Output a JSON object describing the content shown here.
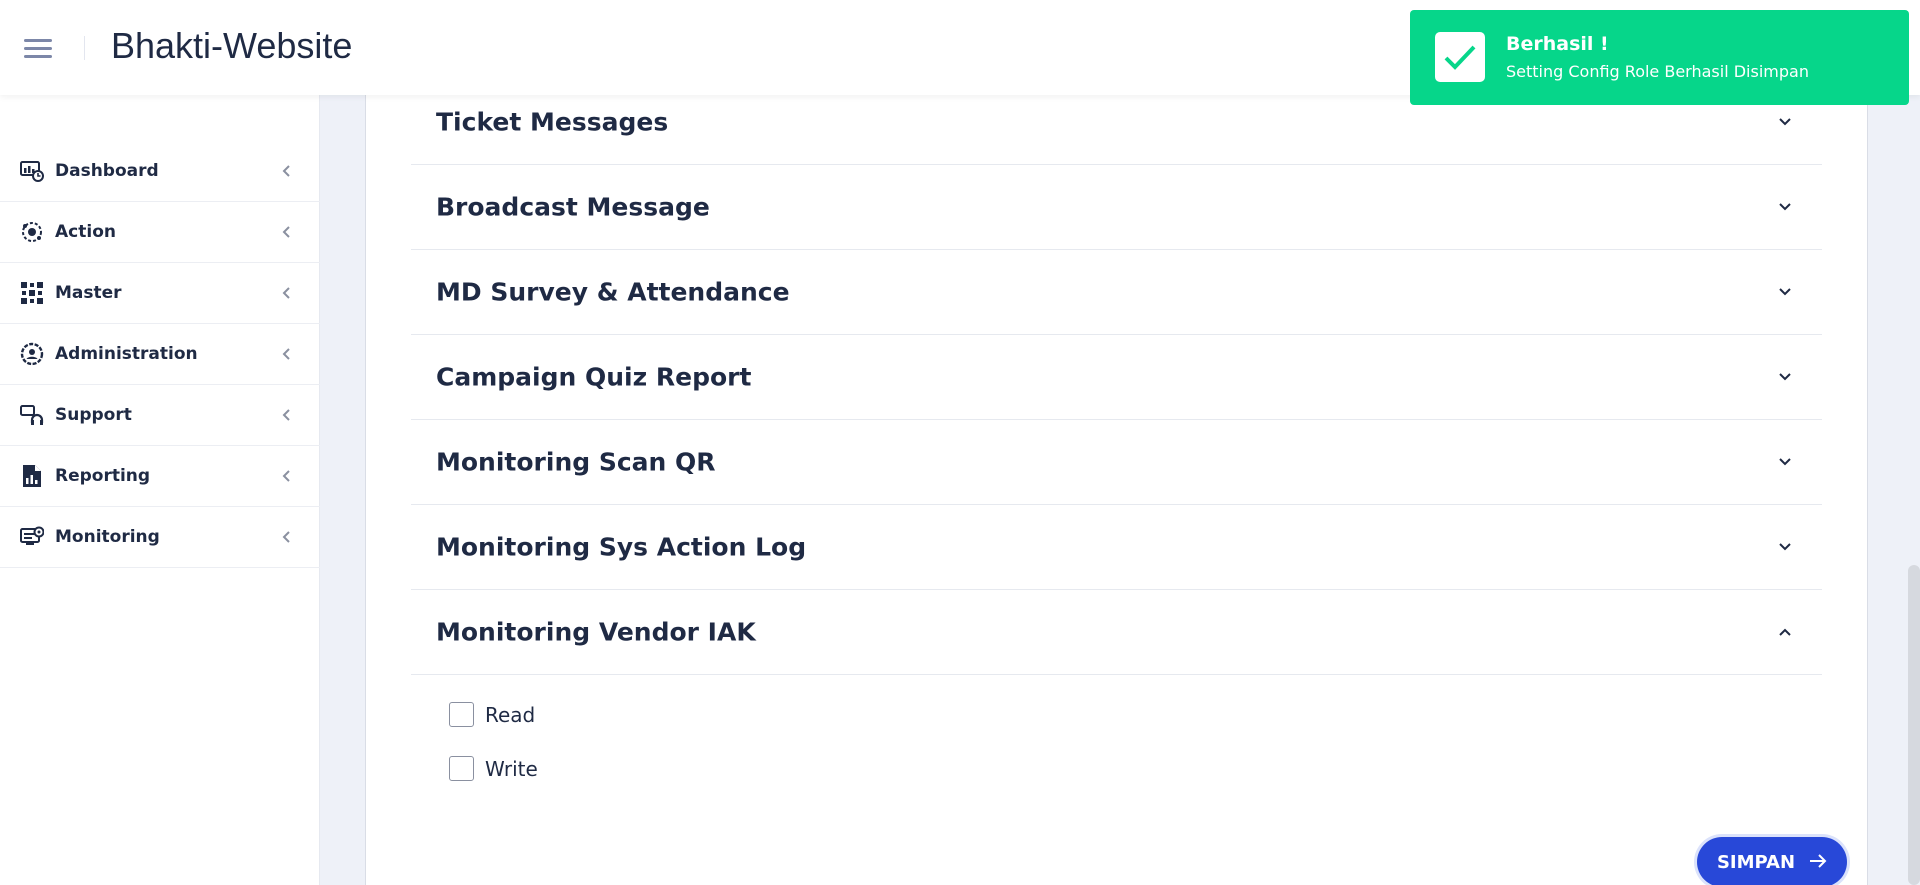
{
  "header": {
    "title": "Bhakti-Website"
  },
  "sidebar": {
    "items": [
      {
        "label": "Dashboard",
        "icon": "dashboard-icon"
      },
      {
        "label": "Action",
        "icon": "action-icon"
      },
      {
        "label": "Master",
        "icon": "master-icon"
      },
      {
        "label": "Administration",
        "icon": "administration-icon"
      },
      {
        "label": "Support",
        "icon": "support-icon"
      },
      {
        "label": "Reporting",
        "icon": "reporting-icon"
      },
      {
        "label": "Monitoring",
        "icon": "monitoring-icon"
      }
    ]
  },
  "accordion": {
    "items": [
      {
        "title": "Ticket Messages",
        "expanded": false
      },
      {
        "title": "Broadcast Message",
        "expanded": false
      },
      {
        "title": "MD Survey & Attendance",
        "expanded": false
      },
      {
        "title": "Campaign Quiz Report",
        "expanded": false
      },
      {
        "title": "Monitoring Scan QR",
        "expanded": false
      },
      {
        "title": "Monitoring Sys Action Log",
        "expanded": false
      },
      {
        "title": "Monitoring Vendor IAK",
        "expanded": true
      }
    ],
    "permissions": [
      {
        "label": "Read",
        "checked": false
      },
      {
        "label": "Write",
        "checked": false
      }
    ]
  },
  "actions": {
    "save_label": "SIMPAN"
  },
  "toast": {
    "title": "Berhasil !",
    "message": "Setting Config Role Berhasil Disimpan"
  },
  "colors": {
    "primary": "#2848d8",
    "success": "#06d68a",
    "text": "#1f2a44",
    "background": "#eef1f8"
  }
}
